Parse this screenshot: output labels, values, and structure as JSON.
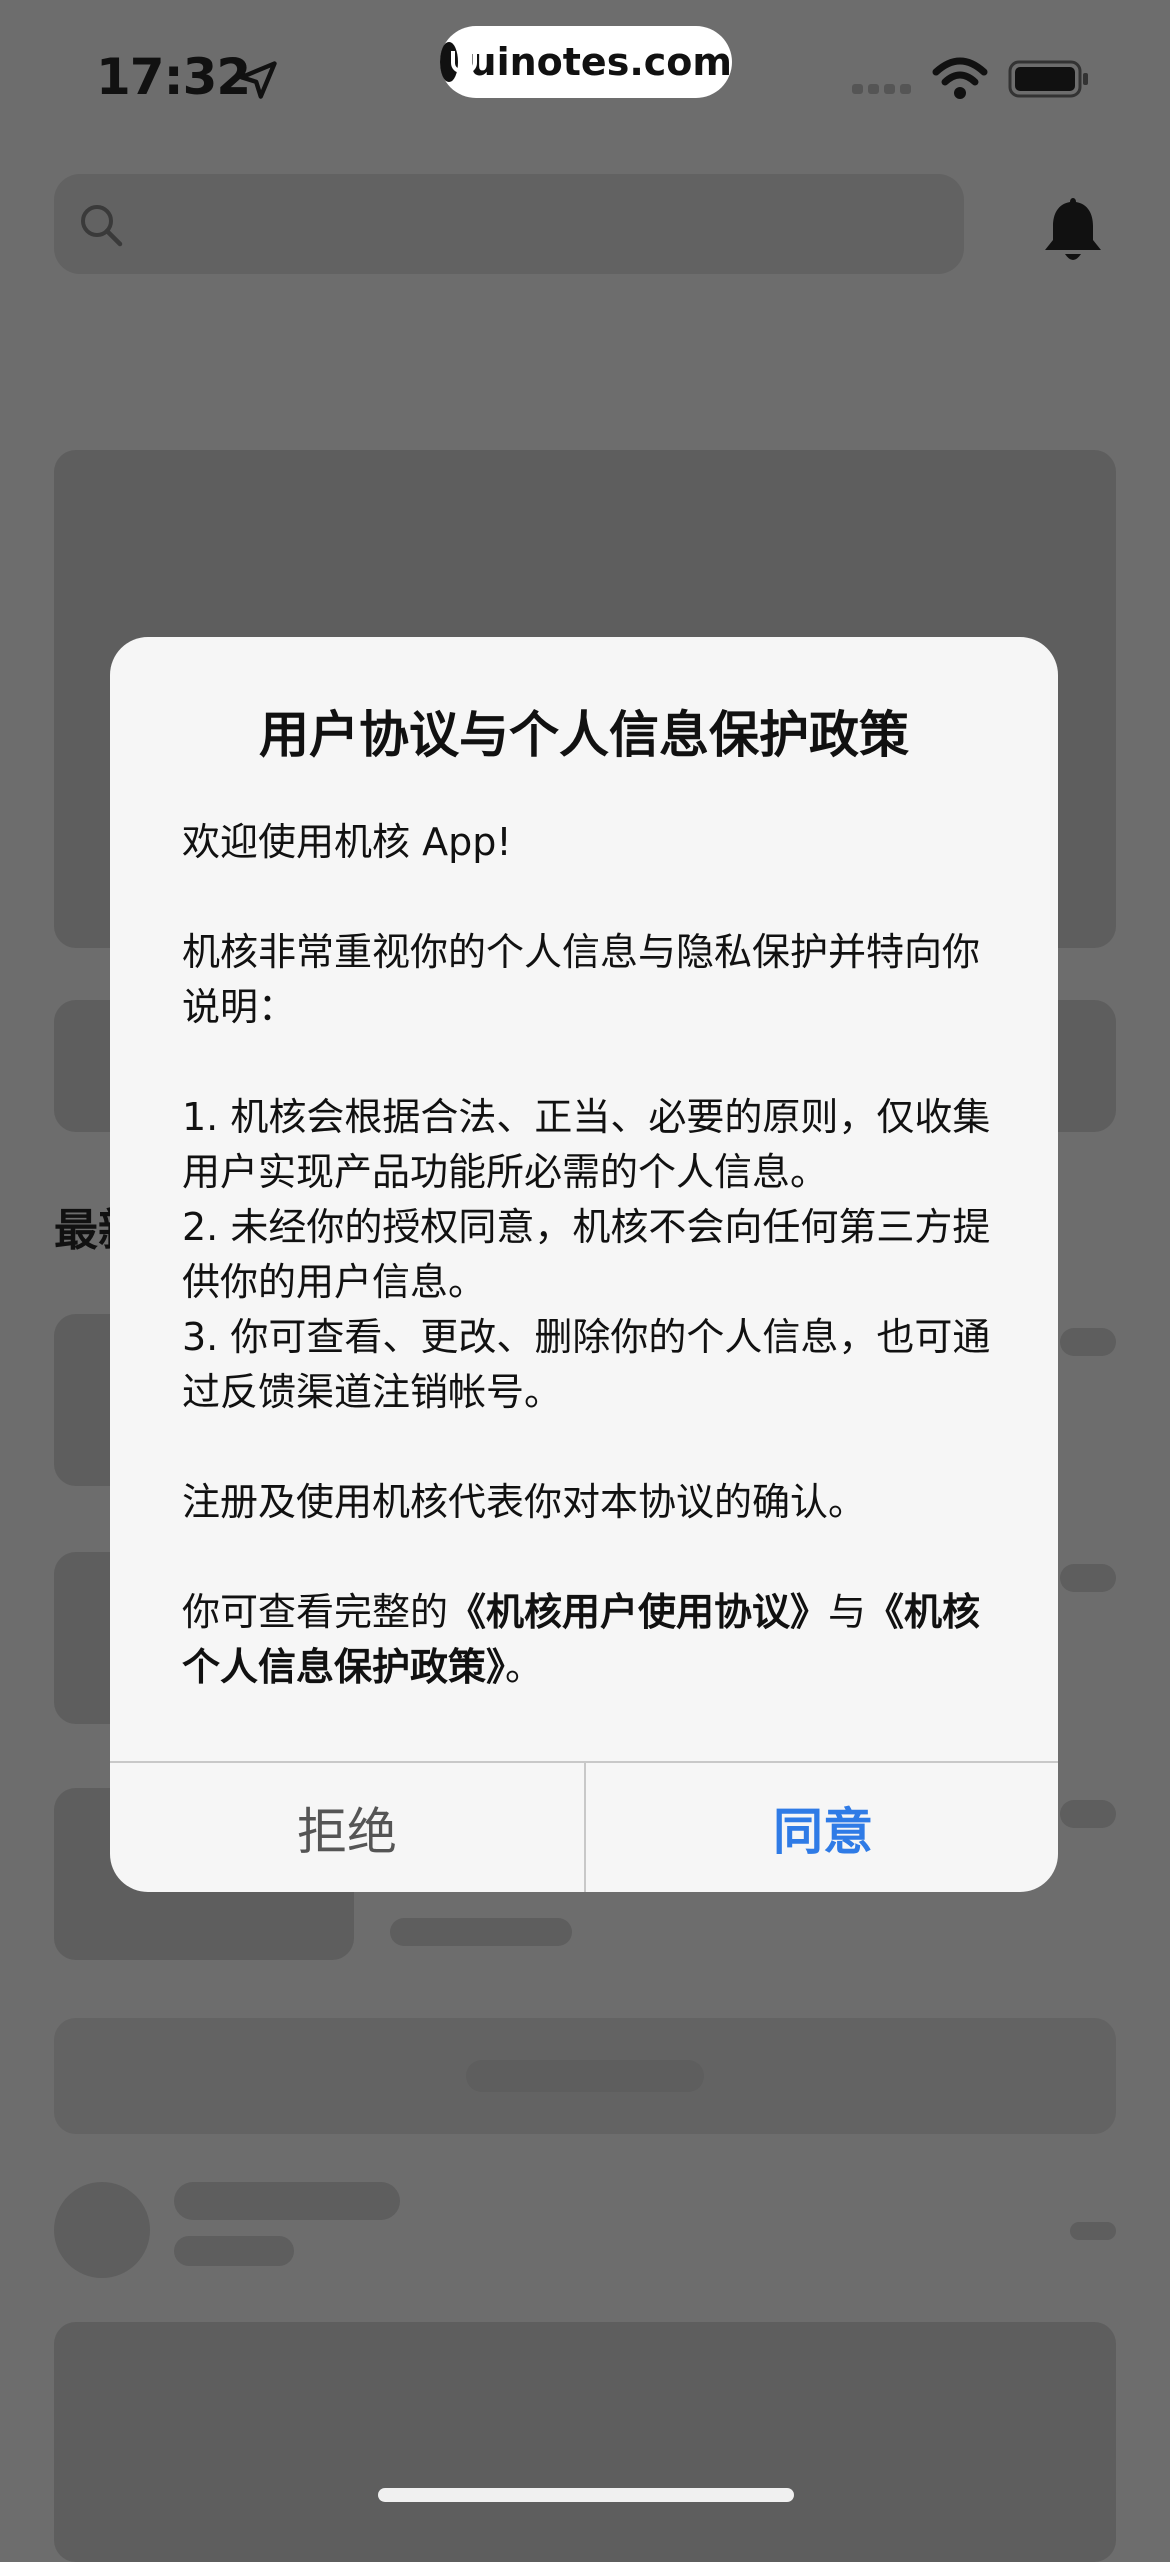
{
  "status_bar": {
    "time": "17:32",
    "url_pill": "uinotes.com",
    "icons": [
      "location-arrow-icon",
      "signal-icon",
      "wifi-icon",
      "battery-icon"
    ]
  },
  "background": {
    "search_placeholder": "",
    "section_partial_title": "最新"
  },
  "dialog": {
    "title": "用户协议与个人信息保护政策",
    "welcome": "欢迎使用机核 App!",
    "intro": "机核非常重视你的个人信息与隐私保护并特向你说明：",
    "point1": "1. 机核会根据合法、正当、必要的原则，仅收集用户实现产品功能所必需的个人信息。",
    "point2": "2. 未经你的授权同意，机核不会向任何第三方提供你的用户信息。",
    "point3": "3. 你可查看、更改、删除你的个人信息，也可通过反馈渠道注销帐号。",
    "confirm_text": "注册及使用机核代表你对本协议的确认。",
    "view_prefix": "你可查看完整的",
    "link_user_agreement": "《机核用户使用协议》",
    "and_text": "与",
    "link_privacy_policy": "《机核个人信息保护政策》",
    "end_period": "。",
    "reject_label": "拒绝",
    "agree_label": "同意",
    "accent_color": "#2f7be6"
  }
}
